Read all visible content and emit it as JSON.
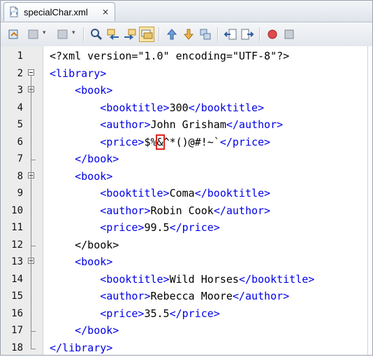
{
  "tab": {
    "filename": "specialChar.xml",
    "close": "×"
  },
  "toolbar": {
    "buttons": [
      "last-edit-icon",
      "back-icon",
      "forward-icon",
      "find-selection-icon",
      "find-previous-icon",
      "find-next-icon",
      "toggle-highlight-icon",
      "previous-bookmark-icon",
      "next-bookmark-icon",
      "toggle-bookmark-icon",
      "shift-left-icon",
      "shift-right-icon",
      "start-macro-icon",
      "stop-macro-icon"
    ]
  },
  "colors": {
    "tag": "#0000e6",
    "highlight_box": "#e2231a"
  },
  "lines": [
    {
      "n": "1",
      "indent": "",
      "tag1": "<?xml",
      "text": " version=\"1.0\" encoding=\"UTF-8\"?>",
      "tag2": ""
    },
    {
      "n": "2",
      "indent": "",
      "tag1": "<library>",
      "text": "",
      "tag2": ""
    },
    {
      "n": "3",
      "indent": "    ",
      "tag1": "<book>",
      "text": "",
      "tag2": ""
    },
    {
      "n": "4",
      "indent": "        ",
      "tag1": "<booktitle>",
      "text": "300",
      "tag2": "</booktitle>"
    },
    {
      "n": "5",
      "indent": "        ",
      "tag1": "<author>",
      "text": "John Grisham",
      "tag2": "</author>"
    },
    {
      "n": "6",
      "indent": "        ",
      "tag1": "<price>",
      "pre": "$%",
      "boxed": "&",
      "text": "^*()@#!~`",
      "tag2": "</price>"
    },
    {
      "n": "7",
      "indent": "    ",
      "tag1": "</book>",
      "text": "",
      "tag2": ""
    },
    {
      "n": "8",
      "indent": "    ",
      "tag1": "<book>",
      "text": "",
      "tag2": ""
    },
    {
      "n": "9",
      "indent": "        ",
      "tag1": "<booktitle>",
      "text": "Coma",
      "tag2": "</booktitle>"
    },
    {
      "n": "10",
      "indent": "        ",
      "tag1": "<author>",
      "text": "Robin Cook",
      "tag2": "</author>"
    },
    {
      "n": "11",
      "indent": "        ",
      "tag1": "<price>",
      "text": "99.5",
      "tag2": "</price>"
    },
    {
      "n": "12",
      "indent": "    ",
      "tag1": "",
      "text": "</book>",
      "tag2": ""
    },
    {
      "n": "13",
      "indent": "    ",
      "tag1": "<book>",
      "text": "",
      "tag2": ""
    },
    {
      "n": "14",
      "indent": "        ",
      "tag1": "<booktitle>",
      "text": "Wild Horses",
      "tag2": "</booktitle>"
    },
    {
      "n": "15",
      "indent": "        ",
      "tag1": "<author>",
      "text": "Rebecca Moore",
      "tag2": "</author>"
    },
    {
      "n": "16",
      "indent": "        ",
      "tag1": "<price>",
      "text": "35.5",
      "tag2": "</price>"
    },
    {
      "n": "17",
      "indent": "    ",
      "tag1": "</book>",
      "text": "",
      "tag2": ""
    },
    {
      "n": "18",
      "indent": "",
      "tag1": "</library>",
      "text": "",
      "tag2": ""
    }
  ]
}
